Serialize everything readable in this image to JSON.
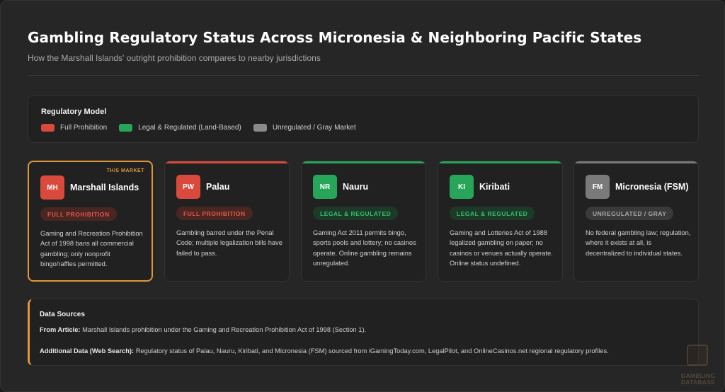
{
  "header": {
    "title": "Gambling Regulatory Status Across Micronesia & Neighboring Pacific States",
    "subtitle": "How the Marshall Islands' outright prohibition compares to nearby jurisdictions"
  },
  "legend": {
    "title": "Regulatory Model",
    "items": [
      {
        "label": "Full Prohibition",
        "color": "#d94a3d"
      },
      {
        "label": "Legal & Regulated (Land-Based)",
        "color": "#27a65a"
      },
      {
        "label": "Unregulated / Gray Market",
        "color": "#8a8a8a"
      }
    ]
  },
  "cards": [
    {
      "marker": "THIS MARKET",
      "code": "MH",
      "name": "Marshall Islands",
      "status": "FULL PROHIBITION",
      "status_type": "prohibition",
      "description": "Gaming and Recreation Prohibition Act of 1998 bans all commercial gambling; only nonprofit bingo/raffles permitted."
    },
    {
      "marker": "",
      "code": "PW",
      "name": "Palau",
      "status": "FULL PROHIBITION",
      "status_type": "prohibition",
      "description": "Gambling barred under the Penal Code; multiple legalization bills have failed to pass."
    },
    {
      "marker": "",
      "code": "NR",
      "name": "Nauru",
      "status": "LEGAL & REGULATED",
      "status_type": "regulated",
      "description": "Gaming Act 2011 permits bingo, sports pools and lottery; no casinos operate. Online gambling remains unregulated."
    },
    {
      "marker": "",
      "code": "KI",
      "name": "Kiribati",
      "status": "LEGAL & REGULATED",
      "status_type": "regulated",
      "description": "Gaming and Lotteries Act of 1988 legalized gambling on paper; no casinos or venues actually operate. Online status undefined."
    },
    {
      "marker": "",
      "code": "FM",
      "name": "Micronesia (FSM)",
      "status": "UNREGULATED / GRAY",
      "status_type": "gray",
      "description": "No federal gambling law; regulation, where it exists at all, is decentralized to individual states."
    }
  ],
  "sources": {
    "title": "Data Sources",
    "article_label": "From Article:",
    "article_text": "Marshall Islands prohibition under the Gaming and Recreation Prohibition Act of 1998 (Section 1).",
    "additional_label": "Additional Data (Web Search):",
    "additional_text": "Regulatory status of Palau, Nauru, Kiribati, and Micronesia (FSM) sourced from iGamingToday.com, LegalPilot, and OnlineCasinos.net regional regulatory profiles."
  },
  "watermark": {
    "text_line1": "GAMBLING",
    "text_line2": "DATABASE"
  },
  "colors": {
    "prohibition": "#d94a3d",
    "prohibition_badge_bg": "#4a2622",
    "prohibition_badge_text": "#e0574a",
    "regulated": "#27a65a",
    "regulated_badge_bg": "#1d3a28",
    "regulated_badge_text": "#34c06a",
    "gray": "#7a7a7a",
    "gray_badge_bg": "#3a3a3a",
    "gray_badge_text": "#a8a8a8",
    "accent": "#e0963a"
  }
}
